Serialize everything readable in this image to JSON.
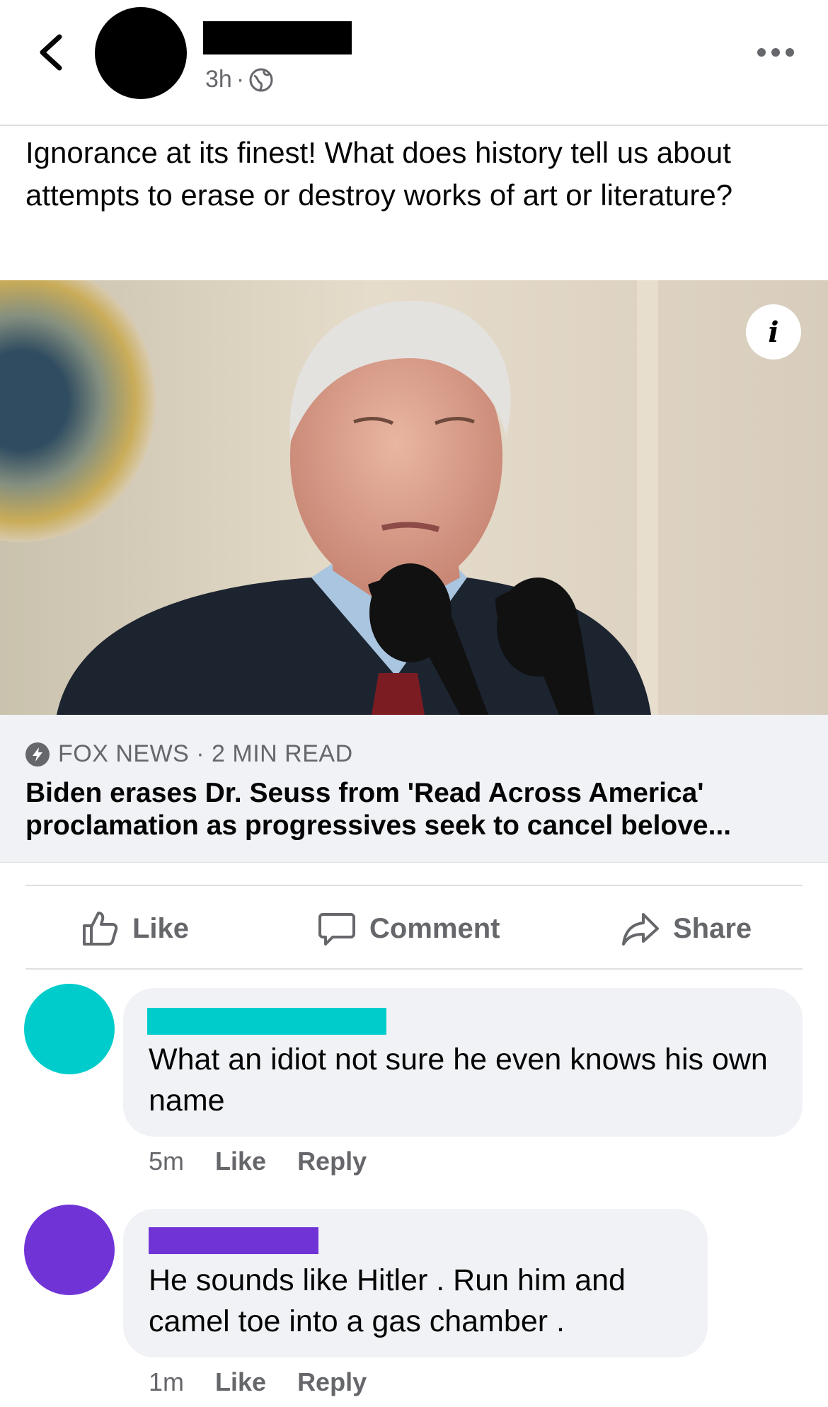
{
  "header": {
    "time": "3h",
    "separator": "·",
    "icons": {
      "back": "chevron-left-icon",
      "privacy": "globe-icon",
      "more": "more-horizontal-icon"
    }
  },
  "post": {
    "text": "Ignorance at its finest! What does history tell us about attempts to erase or destroy works of art or literature?"
  },
  "link": {
    "source": "FOX NEWS · 2 MIN READ",
    "headline": "Biden erases Dr. Seuss from 'Read Across America' proclamation as progressives seek to cancel belove..."
  },
  "actions": {
    "like": "Like",
    "comment": "Comment",
    "share": "Share"
  },
  "comments": [
    {
      "text": "What an idiot not sure he even knows his own name",
      "time": "5m",
      "like": "Like",
      "reply": "Reply",
      "color": "#00cccc"
    },
    {
      "text": "He sounds like Hitler . Run him and camel toe into a gas chamber .",
      "time": "1m",
      "like": "Like",
      "reply": "Reply",
      "color": "#7034d6"
    }
  ],
  "colors": {
    "meta_gray": "#65676b",
    "card_bg": "#f0f2f5"
  }
}
